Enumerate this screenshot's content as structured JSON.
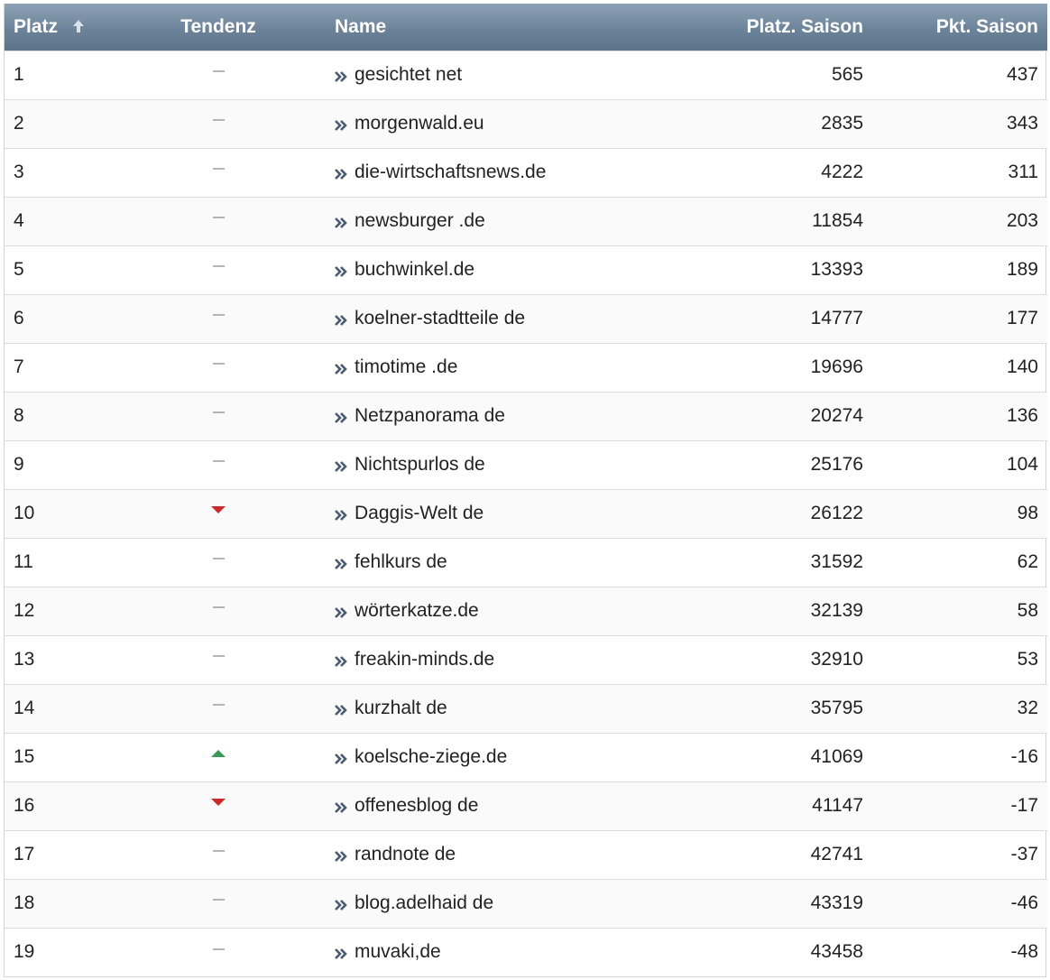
{
  "header": {
    "platz": "Platz",
    "tendenz": "Tendenz",
    "name": "Name",
    "platz_saison": "Platz. Saison",
    "pkt_saison": "Pkt. Saison",
    "sort_icon": "arrow-up-icon"
  },
  "colors": {
    "header_bg": "#6c8399",
    "trend_down": "#cc2a2a",
    "trend_up": "#3c9a58",
    "trend_flat": "#b5b5b5",
    "chevron": "#4a5a70"
  },
  "rows": [
    {
      "platz": "1",
      "trend": "flat",
      "name": "gesichtet net",
      "platz_saison": "565",
      "pkt_saison": "437"
    },
    {
      "platz": "2",
      "trend": "flat",
      "name": "morgenwald.eu",
      "platz_saison": "2835",
      "pkt_saison": "343"
    },
    {
      "platz": "3",
      "trend": "flat",
      "name": "die-wirtschaftsnews.de",
      "platz_saison": "4222",
      "pkt_saison": "311"
    },
    {
      "platz": "4",
      "trend": "flat",
      "name": "newsburger .de",
      "platz_saison": "11854",
      "pkt_saison": "203"
    },
    {
      "platz": "5",
      "trend": "flat",
      "name": "buchwinkel.de",
      "platz_saison": "13393",
      "pkt_saison": "189"
    },
    {
      "platz": "6",
      "trend": "flat",
      "name": "koelner-stadtteile de",
      "platz_saison": "14777",
      "pkt_saison": "177"
    },
    {
      "platz": "7",
      "trend": "flat",
      "name": "timotime .de",
      "platz_saison": "19696",
      "pkt_saison": "140"
    },
    {
      "platz": "8",
      "trend": "flat",
      "name": "Netzpanorama de",
      "platz_saison": "20274",
      "pkt_saison": "136"
    },
    {
      "platz": "9",
      "trend": "flat",
      "name": "Nichtspurlos de",
      "platz_saison": "25176",
      "pkt_saison": "104"
    },
    {
      "platz": "10",
      "trend": "down",
      "name": "Daggis-Welt de",
      "platz_saison": "26122",
      "pkt_saison": "98"
    },
    {
      "platz": "11",
      "trend": "flat",
      "name": "fehlkurs de",
      "platz_saison": "31592",
      "pkt_saison": "62"
    },
    {
      "platz": "12",
      "trend": "flat",
      "name": "wörterkatze.de",
      "platz_saison": "32139",
      "pkt_saison": "58"
    },
    {
      "platz": "13",
      "trend": "flat",
      "name": "freakin-minds.de",
      "platz_saison": "32910",
      "pkt_saison": "53"
    },
    {
      "platz": "14",
      "trend": "flat",
      "name": "kurzhalt de",
      "platz_saison": "35795",
      "pkt_saison": "32"
    },
    {
      "platz": "15",
      "trend": "up",
      "name": "koelsche-ziege.de",
      "platz_saison": "41069",
      "pkt_saison": "-16"
    },
    {
      "platz": "16",
      "trend": "down",
      "name": "offenesblog de",
      "platz_saison": "41147",
      "pkt_saison": "-17"
    },
    {
      "platz": "17",
      "trend": "flat",
      "name": "randnote de",
      "platz_saison": "42741",
      "pkt_saison": "-37"
    },
    {
      "platz": "18",
      "trend": "flat",
      "name": "blog.adelhaid de",
      "platz_saison": "43319",
      "pkt_saison": "-46"
    },
    {
      "platz": "19",
      "trend": "flat",
      "name": "muvaki,de",
      "platz_saison": "43458",
      "pkt_saison": "-48"
    }
  ]
}
